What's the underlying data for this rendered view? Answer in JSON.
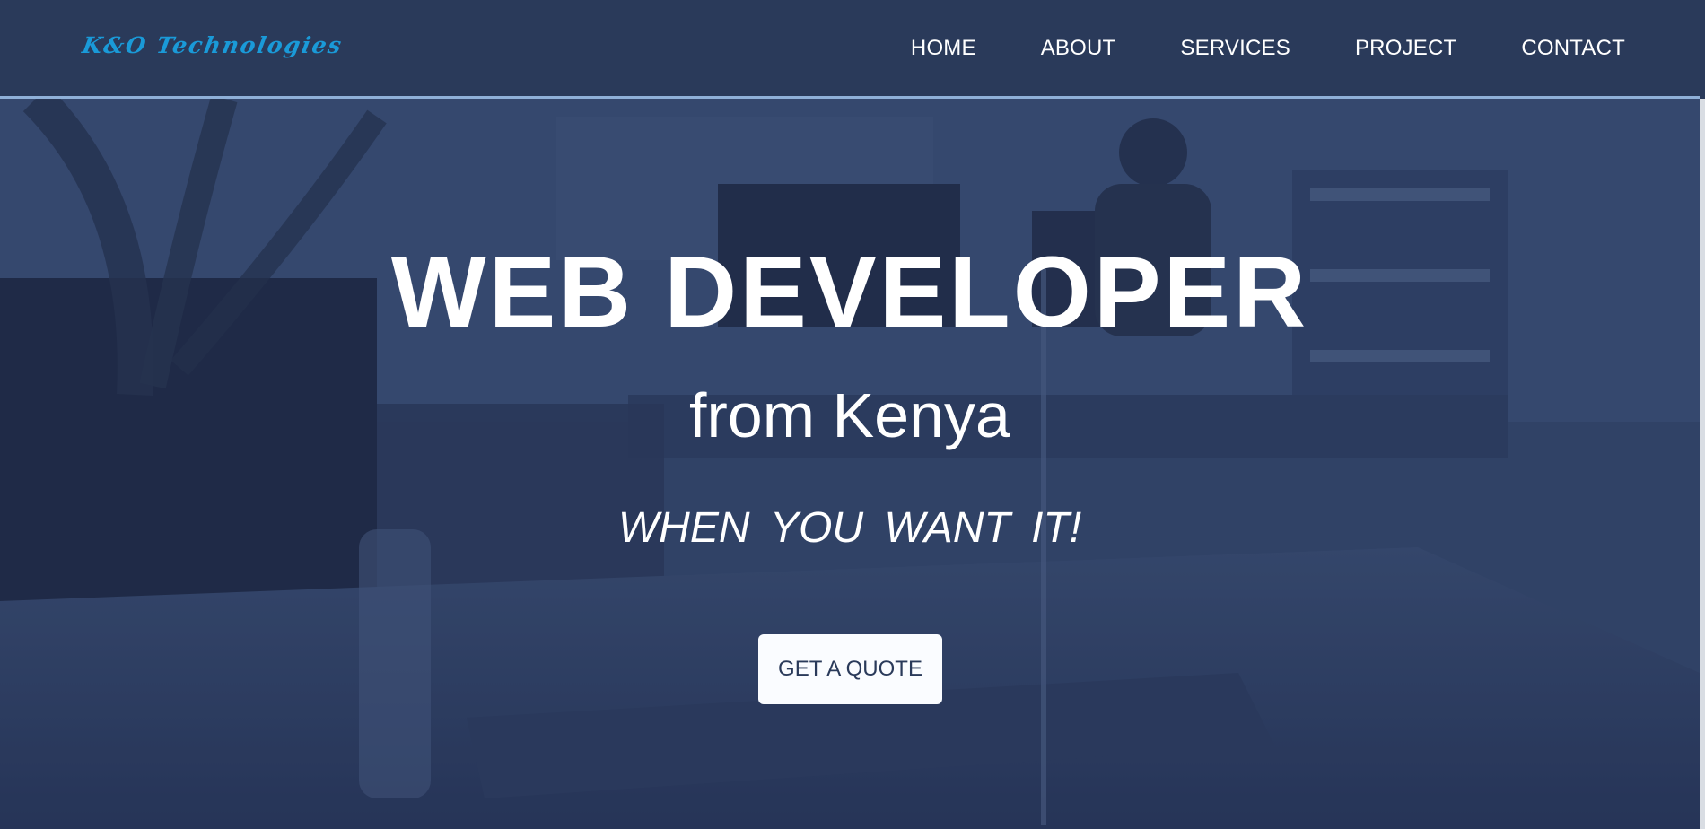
{
  "brand": {
    "logo_text": "K&O Technologies",
    "logo_color": "#1a9ad8"
  },
  "nav": {
    "items": [
      {
        "label": "HOME"
      },
      {
        "label": "ABOUT"
      },
      {
        "label": "SERVICES"
      },
      {
        "label": "PROJECT"
      },
      {
        "label": "CONTACT"
      }
    ]
  },
  "hero": {
    "title": "WEB DEVELOPER",
    "subtitle": "from Kenya",
    "tagline": "WHEN YOU WANT IT!",
    "cta_label": "GET A QUOTE"
  },
  "colors": {
    "navbar_bg": "#2a3a5a",
    "accent_border": "#8fb0d8",
    "text": "#ffffff"
  }
}
